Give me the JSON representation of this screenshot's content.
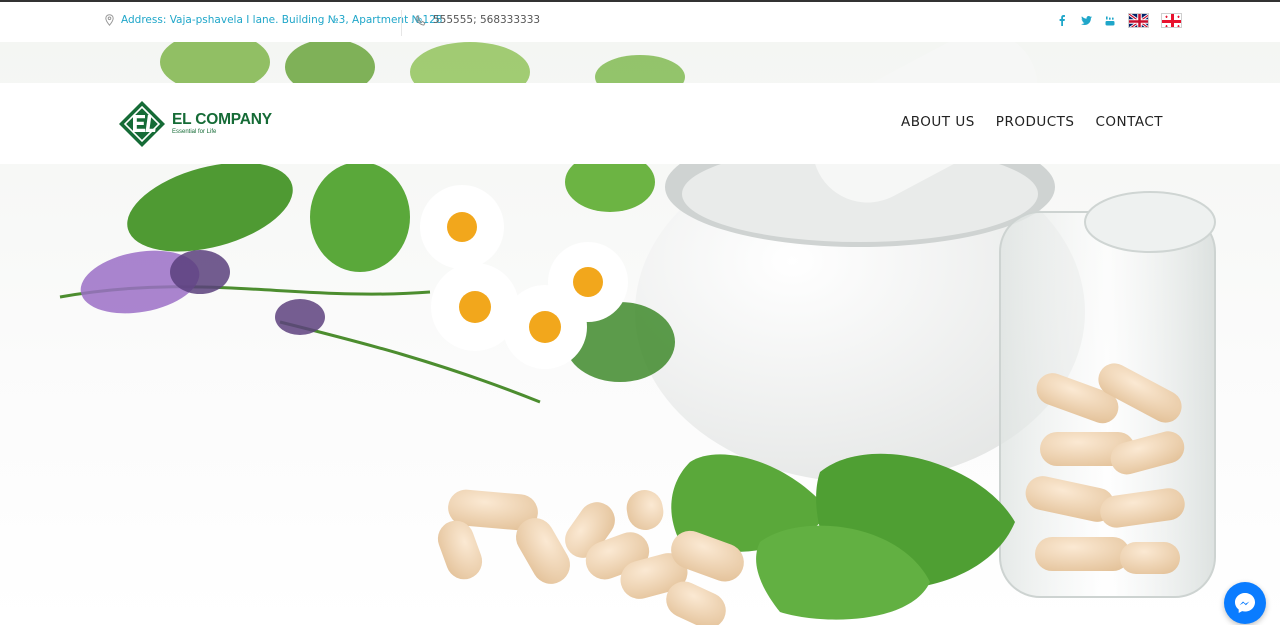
{
  "topbar": {
    "address": "Address: Vaja-pshavela I lane. Building №3, Apartment №128",
    "phone": "555555; 568333333",
    "social": [
      "facebook-icon",
      "twitter-icon",
      "youtube-icon"
    ],
    "languages": [
      "English",
      "Georgian"
    ]
  },
  "header": {
    "logo_name": "EL COMPANY",
    "logo_tagline": "Essential for Life",
    "menu": [
      "ABOUT US",
      "PRODUCTS",
      "CONTACT"
    ]
  },
  "colors": {
    "brand_green": "#156b36",
    "accent_cyan": "#1fa6c9",
    "messenger_blue": "#0a7cff"
  },
  "widget": {
    "messenger_icon": "messenger-icon"
  }
}
